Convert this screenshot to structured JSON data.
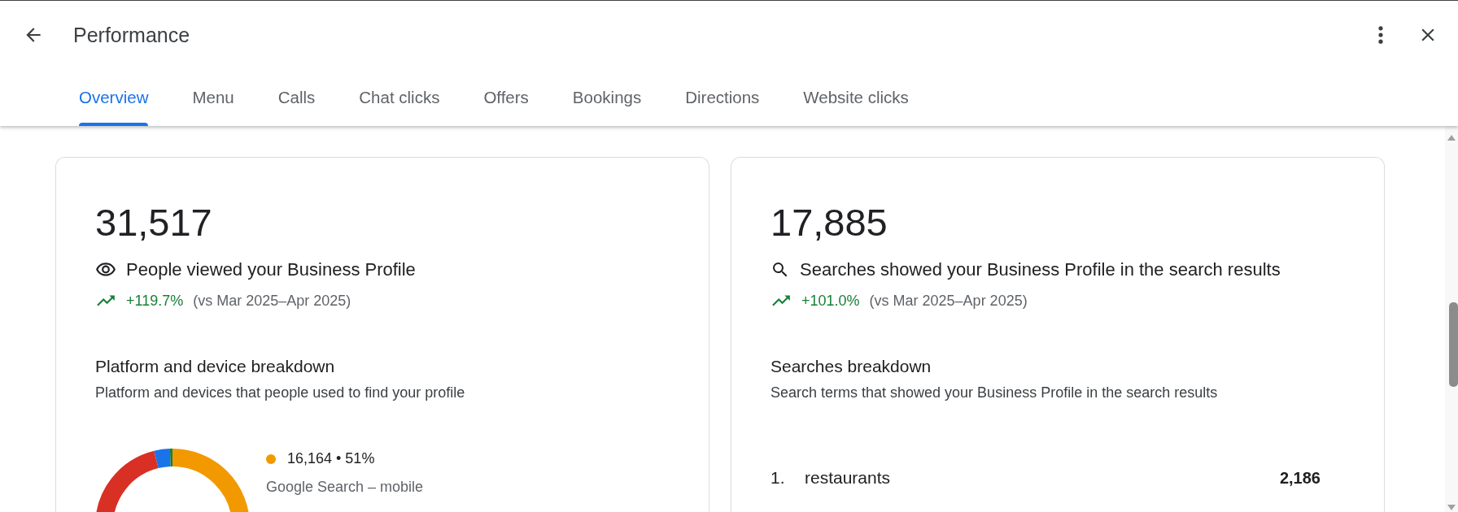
{
  "header": {
    "title": "Performance"
  },
  "tabs": [
    {
      "label": "Overview",
      "selected": true
    },
    {
      "label": "Menu",
      "selected": false
    },
    {
      "label": "Calls",
      "selected": false
    },
    {
      "label": "Chat clicks",
      "selected": false
    },
    {
      "label": "Offers",
      "selected": false
    },
    {
      "label": "Bookings",
      "selected": false
    },
    {
      "label": "Directions",
      "selected": false
    },
    {
      "label": "Website clicks",
      "selected": false
    }
  ],
  "cards": [
    {
      "kind": "views",
      "total": "31,517",
      "description": "People viewed your Business Profile",
      "change": "+119.7%",
      "comparison": "(vs Mar 2025–Apr 2025)",
      "section_title": "Platform and device breakdown",
      "section_subtitle": "Platform and devices that people used to find your profile",
      "legend": [
        {
          "value": "16,164 • 51%",
          "label": "Google Search – mobile",
          "color": "#f29900"
        }
      ]
    },
    {
      "kind": "searches",
      "total": "17,885",
      "description": "Searches showed your Business Profile in the search results",
      "change": "+101.0%",
      "comparison": "(vs Mar 2025–Apr 2025)",
      "section_title": "Searches breakdown",
      "section_subtitle": "Search terms that showed your Business Profile in the search results",
      "terms": [
        {
          "rank": "1.",
          "term": "restaurants",
          "count": "2,186"
        }
      ]
    }
  ]
}
